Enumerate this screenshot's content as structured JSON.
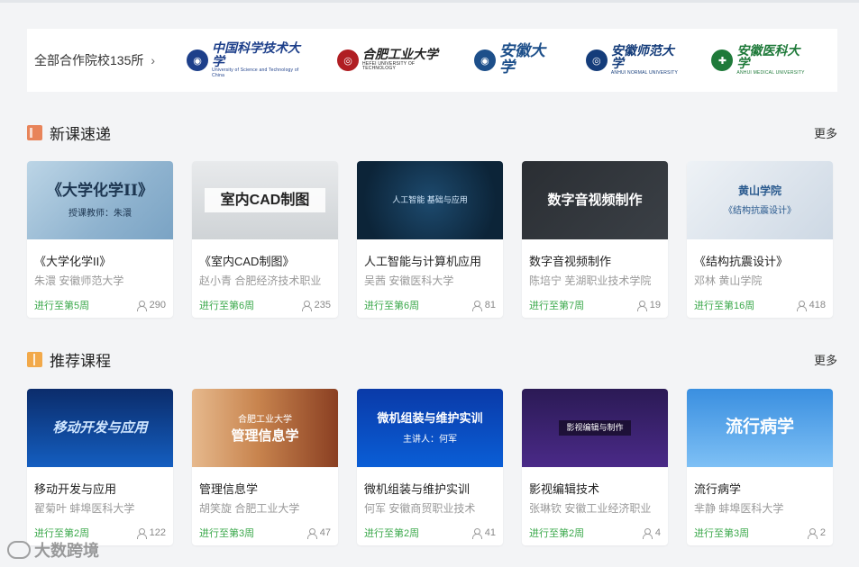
{
  "partners": {
    "all_label": "全部合作院校135所",
    "schools": [
      {
        "name": "中国科学技术大学",
        "sub": "University of Science and Technology of China",
        "icon": "ustc-emblem-icon",
        "color": "#1d3f8a"
      },
      {
        "name": "合肥工业大学",
        "sub": "HEFEI UNIVERSITY OF TECHNOLOGY",
        "icon": "hfut-emblem-icon",
        "color": "#b01e23"
      },
      {
        "name": "安徽大学",
        "sub": "",
        "icon": "ahu-emblem-icon",
        "color": "#1d4f8a"
      },
      {
        "name": "安徽师范大学",
        "sub": "ANHUI NORMAL UNIVERSITY",
        "icon": "ahnu-emblem-icon",
        "color": "#143c7a"
      },
      {
        "name": "安徽医科大学",
        "sub": "ANHUI MEDICAL UNIVERSITY",
        "icon": "ahmu-emblem-icon",
        "color": "#1f7a3a"
      }
    ]
  },
  "new_courses": {
    "title": "新课速递",
    "more": "更多",
    "cards": [
      {
        "cover": "《大学化学II》",
        "cover_sub": "授课教师：朱澴",
        "title": "《大学化学II》",
        "meta": "朱澴 安徽师范大学",
        "progress": "进行至第5周",
        "count": "290"
      },
      {
        "cover": "室内CAD制图",
        "cover_sub": "",
        "title": "《室内CAD制图》",
        "meta": "赵小青 合肥经济技术职业",
        "progress": "进行至第6周",
        "count": "235"
      },
      {
        "cover": "人工智能 基础与应用",
        "cover_sub": "",
        "title": "人工智能与计算机应用",
        "meta": "吴茜 安徽医科大学",
        "progress": "进行至第6周",
        "count": "81"
      },
      {
        "cover": "数字音视频制作",
        "cover_sub": "",
        "title": "数字音视频制作",
        "meta": "陈培宁 芜湖职业技术学院",
        "progress": "进行至第7周",
        "count": "19"
      },
      {
        "cover": "黄山学院",
        "cover_sub": "《结构抗震设计》",
        "title": "《结构抗震设计》",
        "meta": "邓林 黄山学院",
        "progress": "进行至第16周",
        "count": "418"
      }
    ]
  },
  "recommended": {
    "title": "推荐课程",
    "more": "更多",
    "cards": [
      {
        "cover": "移动开发与应用",
        "cover_sub": "",
        "title": "移动开发与应用",
        "meta": "翟菊叶 蚌埠医科大学",
        "progress": "进行至第2周",
        "count": "122"
      },
      {
        "cover": "管理信息学",
        "cover_sub": "合肥工业大学",
        "title": "管理信息学",
        "meta": "胡笑旋 合肥工业大学",
        "progress": "进行至第3周",
        "count": "47"
      },
      {
        "cover": "微机组装与维护实训",
        "cover_sub": "主讲人：何军",
        "title": "微机组装与维护实训",
        "meta": "何军 安徽商贸职业技术",
        "progress": "进行至第2周",
        "count": "41"
      },
      {
        "cover": "影视编辑与制作",
        "cover_sub": "",
        "title": "影视编辑技术",
        "meta": "张琳钦 安徽工业经济职业",
        "progress": "进行至第2周",
        "count": "4"
      },
      {
        "cover": "流行病学",
        "cover_sub": "",
        "title": "流行病学",
        "meta": "芈静 蚌埠医科大学",
        "progress": "进行至第3周",
        "count": "2"
      }
    ]
  },
  "watermark": "大数跨境"
}
